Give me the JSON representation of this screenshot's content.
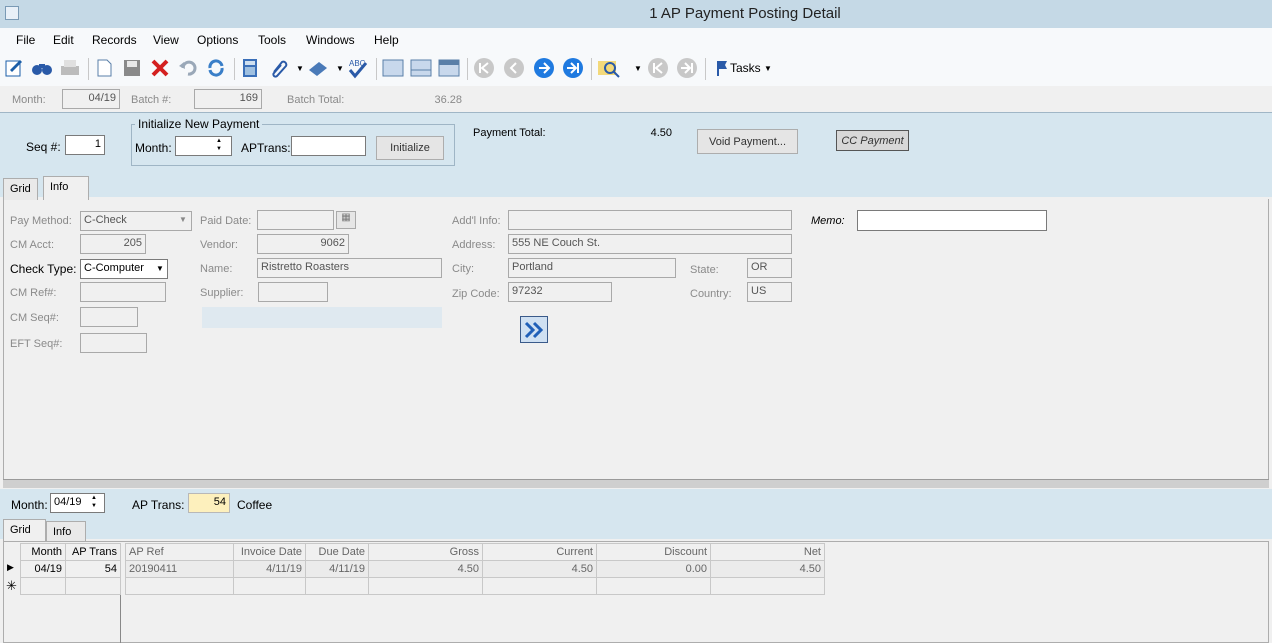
{
  "window": {
    "title": "1 AP Payment Posting Detail"
  },
  "menu": [
    "File",
    "Edit",
    "Records",
    "View",
    "Options",
    "Tools",
    "Windows",
    "Help"
  ],
  "toolbar": {
    "tasks_label": "Tasks"
  },
  "header": {
    "month_label": "Month:",
    "month_value": "04/19",
    "batch_label": "Batch #:",
    "batch_value": "169",
    "batch_total_label": "Batch Total:",
    "batch_total_value": "36.28"
  },
  "payment": {
    "seq_label": "Seq #:",
    "seq_value": "1",
    "init_group": "Initialize New Payment",
    "init_month_label": "Month:",
    "init_month_value": "",
    "aptrans_label": "APTrans:",
    "aptrans_value": "",
    "initialize_btn": "Initialize",
    "total_label": "Payment Total:",
    "total_value": "4.50",
    "void_btn": "Void Payment...",
    "cc_btn": "CC Payment"
  },
  "tabs_top": [
    "Grid",
    "Info"
  ],
  "info": {
    "pay_method_label": "Pay Method:",
    "pay_method": "C-Check",
    "cm_acct_label": "CM Acct:",
    "cm_acct": "205",
    "check_type_label": "Check Type:",
    "check_type": "C-Computer",
    "cm_ref_label": "CM Ref#:",
    "cm_seq_label": "CM Seq#:",
    "eft_seq_label": "EFT Seq#:",
    "paid_date_label": "Paid Date:",
    "vendor_label": "Vendor:",
    "vendor": "9062",
    "name_label": "Name:",
    "name": "Ristretto Roasters",
    "supplier_label": "Supplier:",
    "addl_label": "Add'l Info:",
    "address_label": "Address:",
    "address": "555 NE Couch St.",
    "city_label": "City:",
    "city": "Portland",
    "state_label": "State:",
    "state": "OR",
    "zip_label": "Zip Code:",
    "zip": "97232",
    "country_label": "Country:",
    "country": "US",
    "memo_label": "Memo:",
    "memo": ""
  },
  "lower": {
    "month_label": "Month:",
    "month_value": "04/19",
    "aptrans_label": "AP Trans:",
    "aptrans_value": "54",
    "desc": "Coffee"
  },
  "tabs_bottom": [
    "Grid",
    "Info"
  ],
  "grid": {
    "left_headers": [
      "Month",
      "AP Trans"
    ],
    "headers": [
      "AP Ref",
      "Invoice Date",
      "Due Date",
      "Gross",
      "Current",
      "Discount",
      "Net"
    ],
    "rows": [
      {
        "month": "04/19",
        "aptrans": "54",
        "apref": "20190411",
        "invoice_date": "4/11/19",
        "due_date": "4/11/19",
        "gross": "4.50",
        "current": "4.50",
        "discount": "0.00",
        "net": "4.50"
      }
    ]
  },
  "colors": {
    "band": "#d6e6ef",
    "title": "#c5d9e6"
  }
}
